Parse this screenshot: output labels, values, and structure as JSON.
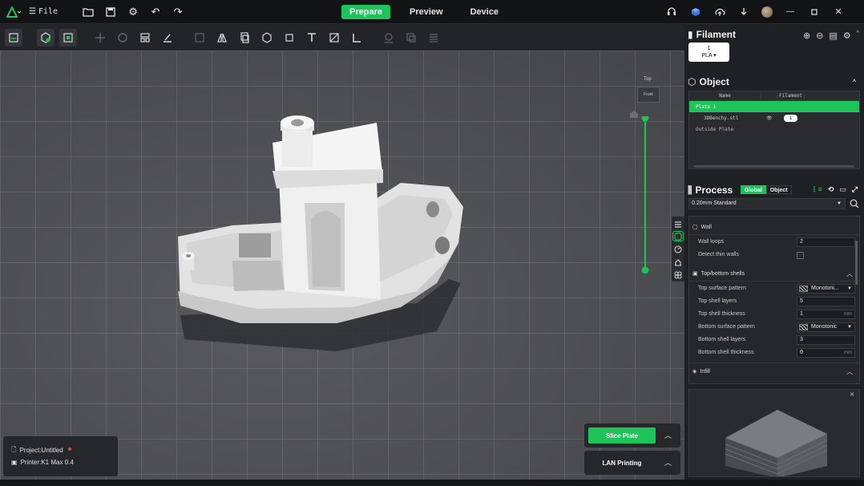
{
  "topbar": {
    "file_label": "File",
    "tabs": [
      {
        "label": "Prepare",
        "active": true
      },
      {
        "label": "Preview",
        "active": false
      },
      {
        "label": "Device",
        "active": false
      }
    ]
  },
  "viewport": {
    "view_cube_top": "Top",
    "view_cube_front": "Front",
    "layer_slider_color": "#1ec35a"
  },
  "info": {
    "project": "Project:Untitled",
    "printer": "Printer:K1 Max 0.4"
  },
  "actions": {
    "slice_label": "Slice Plate",
    "lan_label": "LAN Printing"
  },
  "filament": {
    "title": "Filament",
    "chip_number": "1",
    "chip_type": "PLA"
  },
  "object": {
    "title": "Object",
    "col_name": "Name",
    "col_filament": "Filament",
    "plate": "Plate 1",
    "file": "3DBenchy.stl",
    "file_filament": "1",
    "outside": "Outside Plate"
  },
  "process": {
    "title": "Process",
    "seg_global": "Global",
    "seg_object": "Object",
    "preset": "0.20mm Standard",
    "groups": {
      "wall": "Wall",
      "shells": "Top/bottom shells",
      "infill": "Infill"
    },
    "rows": {
      "wall_loops": {
        "label": "Wall loops",
        "value": "2"
      },
      "detect_thin": {
        "label": "Detect thin walls"
      },
      "top_pattern": {
        "label": "Top surface pattern",
        "value": "Monotoni..."
      },
      "top_layers": {
        "label": "Top shell layers",
        "value": "5"
      },
      "top_thickness": {
        "label": "Top shell thickness",
        "value": "1",
        "unit": "mm"
      },
      "bottom_pattern": {
        "label": "Bottom surface pattern",
        "value": "Monotonic"
      },
      "bottom_layers": {
        "label": "Bottom shell layers",
        "value": "3"
      },
      "bottom_thickness": {
        "label": "Bottom shell thickness",
        "value": "0",
        "unit": "mm"
      }
    }
  },
  "colors": {
    "accent": "#1ec35a",
    "background": "#1f2023",
    "viewport": "#505155"
  }
}
